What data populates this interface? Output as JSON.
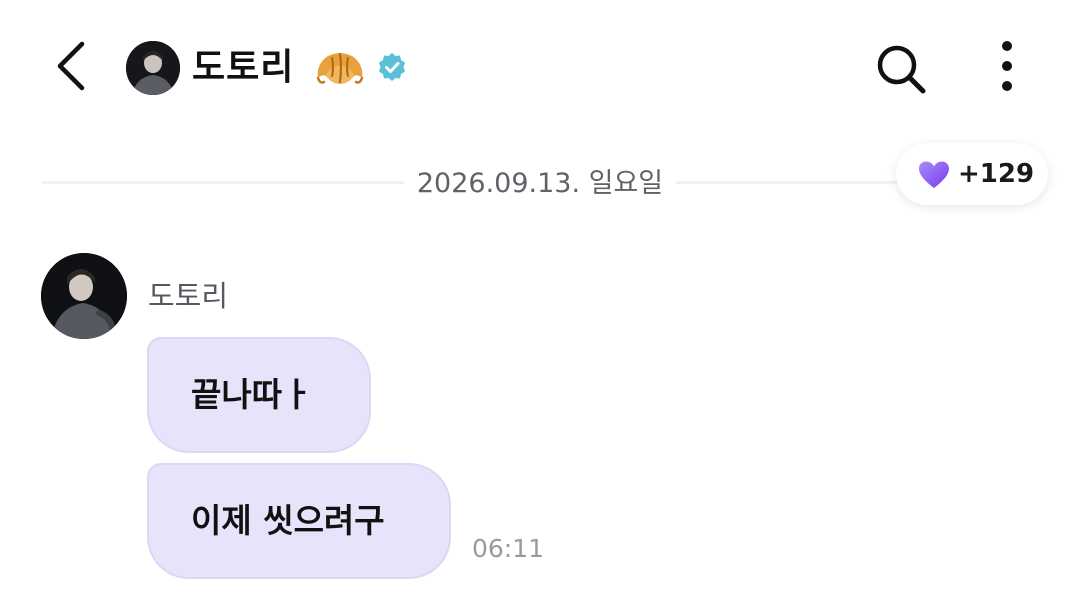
{
  "header": {
    "title": "도토리",
    "icons": [
      "back-arrow-icon",
      "avatar",
      "croissant-icon",
      "verified-badge-icon",
      "search-icon",
      "more-vertical-icon"
    ],
    "verified_color": "#5bc0d6"
  },
  "date_divider": {
    "text": "2026.09.13. 일요일"
  },
  "reaction": {
    "icon": "purple-heart-icon",
    "count": "+129",
    "heart_color": "#8b5cf6"
  },
  "messages": {
    "sender": "도토리",
    "bubble_color": "#e6e3fb",
    "items": [
      {
        "text": "끝나따ㅏ"
      },
      {
        "text": "이제 씻으려구"
      }
    ],
    "time": "06:11"
  }
}
